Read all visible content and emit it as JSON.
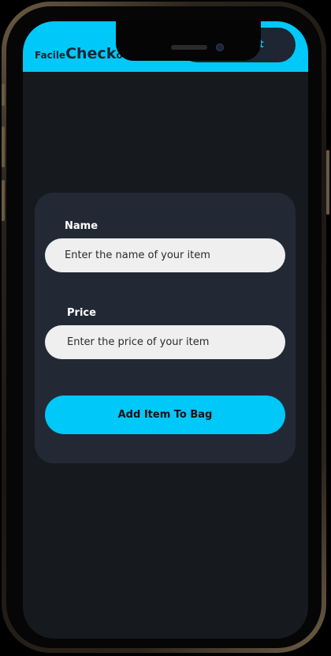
{
  "header": {
    "logo_prefix": "Facile",
    "logo_main": "Check",
    "logo_suffix": "out",
    "checkout_label": "checkout"
  },
  "form": {
    "name_label": "Name",
    "name_placeholder": "Enter the name of your item",
    "price_label": "Price",
    "price_placeholder": "Enter the price of your item",
    "submit_label": "Add Item To Bag"
  },
  "colors": {
    "accent": "#00c8f8",
    "background": "#16191d",
    "card": "#222935",
    "dark_button": "#1f2633",
    "input": "#efefef"
  }
}
